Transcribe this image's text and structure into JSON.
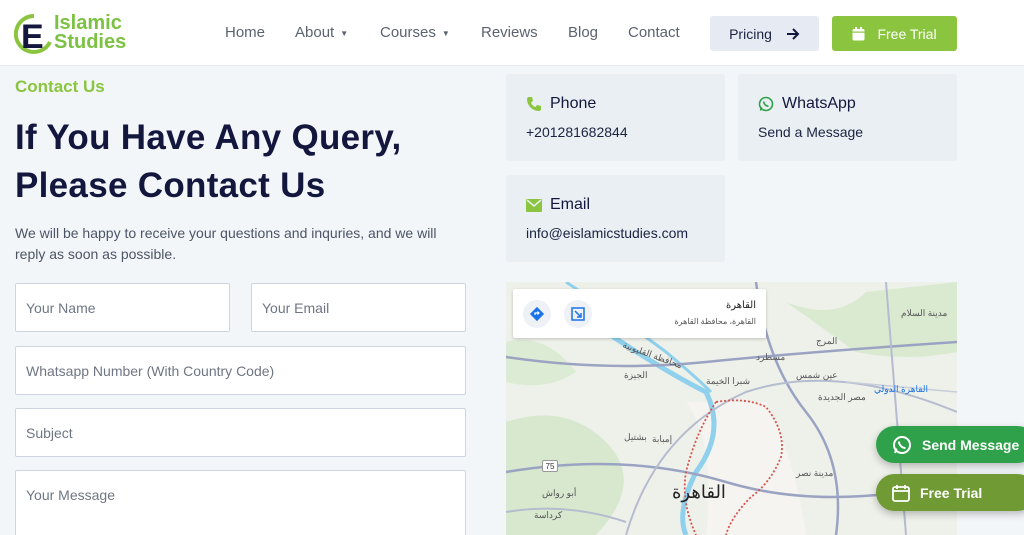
{
  "brand": {
    "line1": "Islamic",
    "line2": "Studies",
    "mark": "E"
  },
  "nav": {
    "items": [
      {
        "label": "Home",
        "dropdown": false
      },
      {
        "label": "About",
        "dropdown": true
      },
      {
        "label": "Courses",
        "dropdown": true
      },
      {
        "label": "Reviews",
        "dropdown": false
      },
      {
        "label": "Blog",
        "dropdown": false
      },
      {
        "label": "Contact",
        "dropdown": false
      }
    ],
    "pricing_label": "Pricing",
    "free_trial_label": "Free Trial"
  },
  "contact": {
    "eyebrow": "Contact Us",
    "headline_line1": "If You Have Any Query,",
    "headline_line2": "Please Contact Us",
    "subtext": "We will be happy to receive your questions and inquries, and we will reply as soon as possible."
  },
  "form": {
    "name_placeholder": "Your Name",
    "email_placeholder": "Your Email",
    "whatsapp_placeholder": "Whatsapp Number (With Country Code)",
    "subject_placeholder": "Subject",
    "message_placeholder": "Your Message"
  },
  "cards": {
    "phone": {
      "title": "Phone",
      "value": "+201281682844"
    },
    "whatsapp": {
      "title": "WhatsApp",
      "value": "Send a Message"
    },
    "email": {
      "title": "Email",
      "value": "info@eislamicstudies.com"
    }
  },
  "map": {
    "place_title": "القاهرة",
    "place_subtitle": "القاهرة، محافظة القاهرة",
    "city_label": "القاهرة",
    "labels": [
      "مدينة السلام",
      "مسطرد",
      "شبرا الخيمة",
      "عين شمس",
      "محافظة القليوبية",
      "الجيزة",
      "إمبابة",
      "بشتيل",
      "مصر الجديدة",
      "مدينة نصر",
      "أبو رواش",
      "كرداسة",
      "القاهرة الدولي",
      "المرج"
    ],
    "route_number": "75"
  },
  "floating": {
    "send_message": "Send Message",
    "free_trial": "Free Trial"
  },
  "colors": {
    "accent": "#8bc53f",
    "navy": "#14173d",
    "whatsapp": "#2fa14a"
  }
}
